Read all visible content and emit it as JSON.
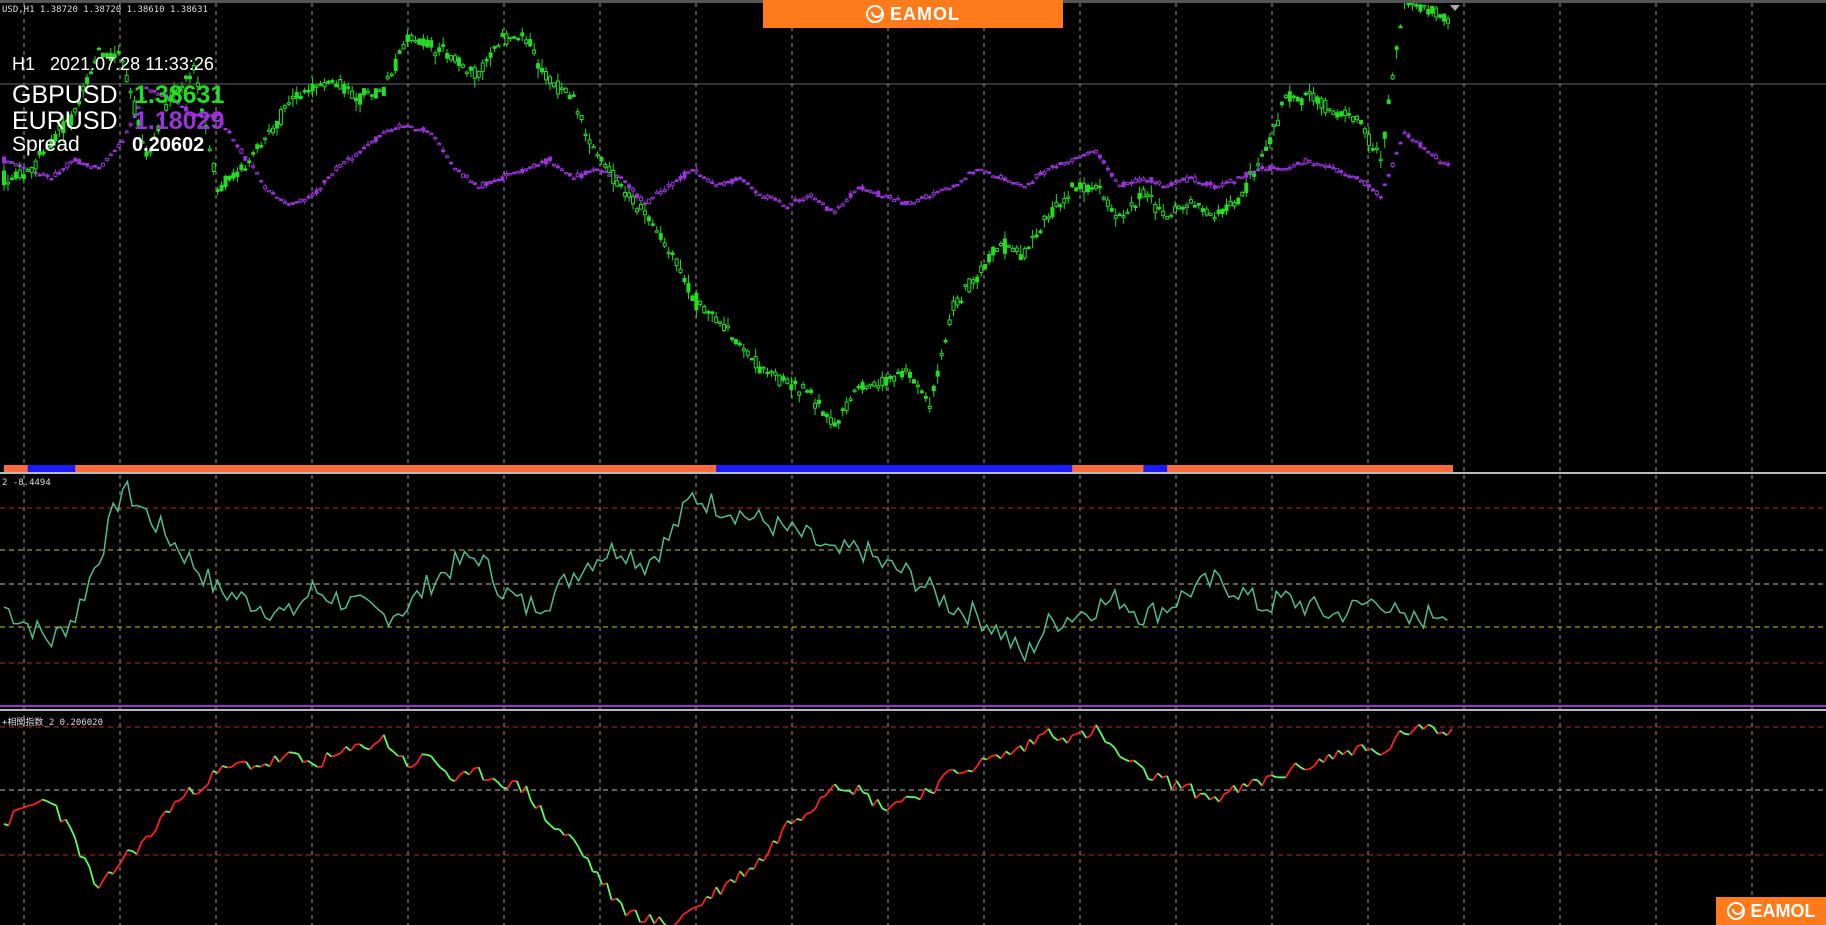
{
  "header": {
    "symbol_line": "USD,H1  1.38720 1.38720 1.38610 1.38631",
    "timeframe": "H1",
    "timestamp": "2021.07.28 11:33:26"
  },
  "symbols": [
    {
      "name": "GBPUSD",
      "value": "1.38631",
      "color": "#22dd22"
    },
    {
      "name": "EURUSD",
      "value": "1.18029",
      "color": "#9a32d9"
    }
  ],
  "spread": {
    "label": "Spread",
    "value": "0.20602"
  },
  "indicators": {
    "panel2_label": "2 -8.4494",
    "panel3_label": "+相関指数_2 0.206020"
  },
  "brand": {
    "name": "EAMOL",
    "color": "#ff7a1a"
  },
  "colors": {
    "gbp": "#22dd22",
    "eur": "#9a32d9",
    "osc": "#4fbf8a",
    "ratio_up": "#5cff5c",
    "ratio_down": "#ff2020",
    "grid": "#cfcfcf",
    "level_red": "#cc2222",
    "level_yellow": "#c8c800",
    "trend_up": "#ff6a3c",
    "trend_down": "#1a1aff"
  },
  "series": {
    "gbp": [
      1.3785,
      1.379,
      1.381,
      1.383,
      1.387,
      1.3865,
      1.38,
      1.3835,
      1.386,
      1.378,
      1.379,
      1.381,
      1.3835,
      1.3845,
      1.385,
      1.384,
      1.3845,
      1.388,
      1.3875,
      1.3865,
      1.3855,
      1.388,
      1.388,
      1.385,
      1.384,
      1.38,
      1.378,
      1.376,
      1.374,
      1.3705,
      1.369,
      1.3675,
      1.3655,
      1.365,
      1.364,
      1.362,
      1.3645,
      1.365,
      1.3655,
      1.3635,
      1.37,
      1.372,
      1.374,
      1.3735,
      1.376,
      1.378,
      1.378,
      1.376,
      1.3775,
      1.376,
      1.377,
      1.376,
      1.377,
      1.38,
      1.384,
      1.384,
      1.383,
      1.3825,
      1.38,
      1.3905,
      1.39,
      1.389
    ],
    "eur": [
      1.1805,
      1.18,
      1.1795,
      1.1805,
      1.18,
      1.1815,
      1.1845,
      1.184,
      1.183,
      1.183,
      1.181,
      1.179,
      1.178,
      1.1785,
      1.18,
      1.181,
      1.182,
      1.1825,
      1.182,
      1.18,
      1.179,
      1.1795,
      1.18,
      1.1805,
      1.1795,
      1.18,
      1.1795,
      1.178,
      1.179,
      1.18,
      1.179,
      1.1795,
      1.1785,
      1.178,
      1.1785,
      1.1775,
      1.179,
      1.1785,
      1.178,
      1.1785,
      1.179,
      1.18,
      1.1795,
      1.179,
      1.18,
      1.1805,
      1.181,
      1.179,
      1.1795,
      1.179,
      1.1795,
      1.179,
      1.1795,
      1.18,
      1.18,
      1.1805,
      1.18,
      1.1795,
      1.1785,
      1.182,
      1.181,
      1.18
    ],
    "osc": [
      -2,
      -4,
      -6,
      -3,
      4,
      12,
      9,
      6,
      3,
      0,
      -1,
      -2,
      -3,
      0,
      -1,
      -2,
      -3,
      -2,
      1,
      3,
      4,
      0,
      -2,
      -1,
      2,
      4,
      5,
      3,
      6,
      11,
      10,
      9,
      8,
      7,
      6,
      4,
      5,
      3,
      2,
      0,
      -2,
      -3,
      -5,
      -8,
      -4,
      -3,
      -2,
      -1,
      -3,
      -2,
      0,
      1,
      0,
      -2,
      -1,
      -2,
      -3,
      -2,
      -1,
      -4,
      -3,
      -2
    ],
    "ratio": [
      -2,
      -1,
      -0.5,
      -3,
      -6,
      -4,
      -3,
      -1,
      0,
      1,
      1.5,
      1.5,
      2,
      1.5,
      2,
      2.5,
      3,
      1.5,
      2,
      0.5,
      1,
      0.5,
      0,
      -2,
      -3,
      -5,
      -7,
      -7.5,
      -8,
      -7,
      -6,
      -5,
      -4,
      -2,
      -1,
      0.5,
      0,
      -1,
      -0.5,
      0,
      1,
      1.5,
      2,
      2.5,
      3.5,
      3,
      3.5,
      2,
      1,
      0.5,
      0,
      -0.5,
      0,
      0.5,
      1,
      1.5,
      2,
      2.5,
      2,
      3.5,
      3.5,
      3.5
    ],
    "trend": [
      1,
      0,
      0,
      1,
      1,
      1,
      1,
      1,
      1,
      1,
      1,
      1,
      1,
      1,
      1,
      1,
      1,
      1,
      1,
      1,
      1,
      1,
      1,
      1,
      1,
      1,
      1,
      1,
      1,
      1,
      0,
      0,
      0,
      0,
      0,
      0,
      0,
      0,
      0,
      0,
      0,
      0,
      0,
      0,
      0,
      1,
      1,
      1,
      0,
      1,
      1,
      1,
      1,
      1,
      1,
      1,
      1,
      1,
      1,
      1,
      1,
      1
    ]
  }
}
